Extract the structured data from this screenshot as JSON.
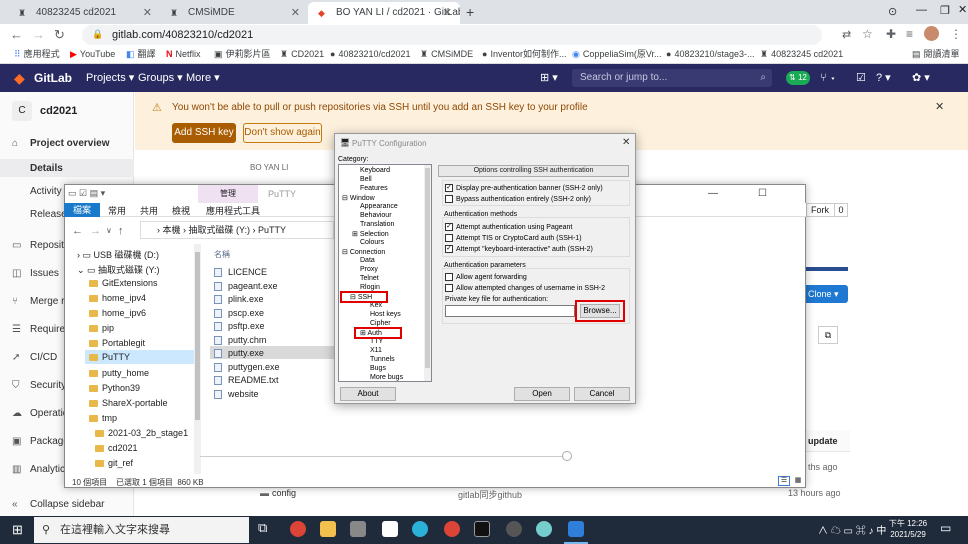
{
  "browser": {
    "tabs": [
      {
        "label": "40823245 cd2021",
        "active": false
      },
      {
        "label": "CMSiMDE",
        "active": false
      },
      {
        "label": "BO YAN LI / cd2021 · GitLab",
        "active": true
      }
    ],
    "url": "gitlab.com/40823210/cd2021",
    "bookmarks": [
      "應用程式",
      "YouTube",
      "翻譯",
      "Netflix",
      "伊莉影片區",
      "CD2021",
      "40823210/cd2021",
      "CMSiMDE",
      "Inventor如何制作...",
      "CoppeliaSim(原Vr...",
      "40823210/stage3-...",
      "40823245 cd2021",
      "閱讀清單"
    ]
  },
  "gitlab": {
    "brand": "GitLab",
    "nav": [
      "Projects ▾",
      "Groups ▾",
      "More ▾"
    ],
    "search_placeholder": "Search or jump to...",
    "badge_mr": "12",
    "project_initial": "C",
    "project_name": "cd2021",
    "sidebar": [
      "Project overview",
      "Details",
      "Activity",
      "Releases",
      "Repository",
      "Issues",
      "Merge re...",
      "Requirem...",
      "CI/CD",
      "Security &...",
      "Operation...",
      "Packages...",
      "Analytics",
      "Collapse sidebar"
    ],
    "warning": "You won't be able to pull or push repositories via SSH until you add an SSH key to your profile",
    "add_ssh": "Add SSH key",
    "dont_show": "Don't show again",
    "breadcrumb": "BO YAN LI",
    "fork_label": "Fork",
    "fork_count": "0",
    "clone": "Clone ▾",
    "col_update": "update",
    "ago1": "ths ago",
    "row_config": "config",
    "row_config_msg": "gitlab同步github",
    "row_config_time": "13 hours ago"
  },
  "explorer": {
    "title": "PuTTY",
    "context_tab": "管理",
    "context_sub": "應用程式工具",
    "ribbon": [
      "檔案",
      "常用",
      "共用",
      "檢視"
    ],
    "path": [
      "本機",
      "抽取式磁碟 (Y:)",
      "PuTTY"
    ],
    "header_name": "名稱",
    "tree": [
      "USB 磁碟機 (D:)",
      "抽取式磁碟 (Y:)",
      "GitExtensions",
      "home_ipv4",
      "home_ipv6",
      "pip",
      "Portablegit",
      "PuTTY",
      "putty_home",
      "Python39",
      "ShareX-portable",
      "tmp",
      "2021-03_2b_stage1",
      "cd2021",
      "git_ref"
    ],
    "files": [
      "LICENCE",
      "pageant.exe",
      "plink.exe",
      "pscp.exe",
      "psftp.exe",
      "putty.chm",
      "putty.exe",
      "puttygen.exe",
      "README.txt",
      "website"
    ],
    "status": "10 個項目    已選取 1 個項目  860 KB"
  },
  "putty": {
    "title": "PuTTY Configuration",
    "category_label": "Category:",
    "tree": [
      "Keyboard",
      "Bell",
      "Features",
      "Window",
      "Appearance",
      "Behaviour",
      "Translation",
      "Selection",
      "Colours",
      "Connection",
      "Data",
      "Proxy",
      "Telnet",
      "Rlogin",
      "SSH",
      "Kex",
      "Host keys",
      "Cipher",
      "Auth",
      "TTY",
      "X11",
      "Tunnels",
      "Bugs",
      "More bugs"
    ],
    "header": "Options controlling SSH authentication",
    "opt1": "Display pre-authentication banner (SSH-2 only)",
    "opt2": "Bypass authentication entirely (SSH-2 only)",
    "methods_title": "Authentication methods",
    "m1": "Attempt authentication using Pageant",
    "m2": "Attempt TIS or CryptoCard auth (SSH-1)",
    "m3": "Attempt \"keyboard-interactive\" auth (SSH-2)",
    "params_title": "Authentication parameters",
    "p1": "Allow agent forwarding",
    "p2": "Allow attempted changes of username in SSH-2",
    "keyfile_label": "Private key file for authentication:",
    "browse": "Browse...",
    "about": "About",
    "open": "Open",
    "cancel": "Cancel"
  },
  "taskbar": {
    "search": "在這裡輸入文字來搜尋",
    "time": "下午 12:26",
    "date": "2021/5/29"
  }
}
